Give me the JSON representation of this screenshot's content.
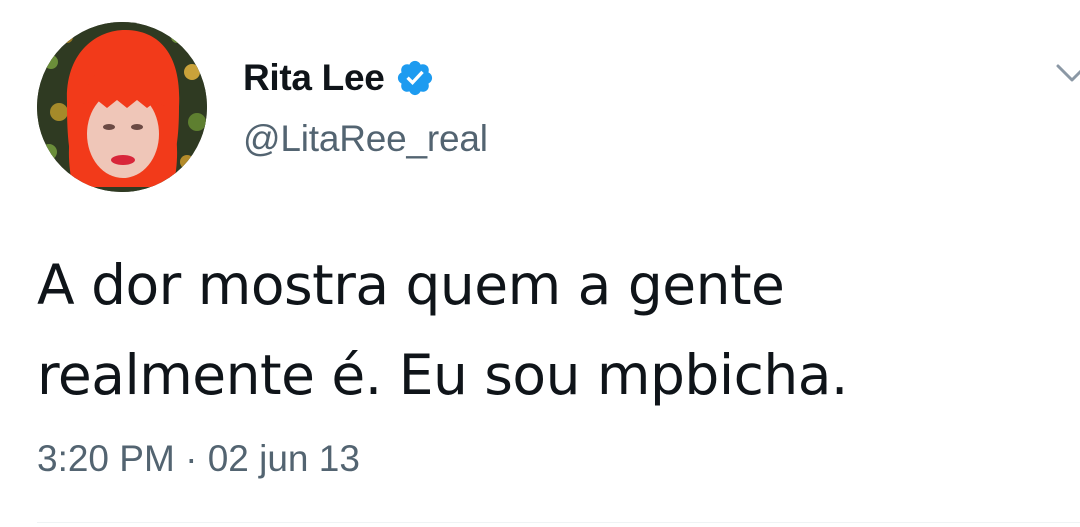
{
  "author": {
    "display_name": "Rita Lee",
    "handle": "@LitaRee_real",
    "verified": true,
    "verified_icon": "verified-badge-icon",
    "avatar_icon": "profile-avatar"
  },
  "tweet": {
    "text_line_1": "A dor mostra quem a gente",
    "text_line_2": "realmente é. Eu sou mpbicha.",
    "time": "3:20 PM",
    "separator": " · ",
    "date": "02 jun 13"
  },
  "menu": {
    "icon": "chevron-down-icon"
  },
  "colors": {
    "verified_blue": "#1d9bf0",
    "text_primary": "#0f1419",
    "text_secondary": "#536471",
    "hair_red": "#f23a1a"
  }
}
